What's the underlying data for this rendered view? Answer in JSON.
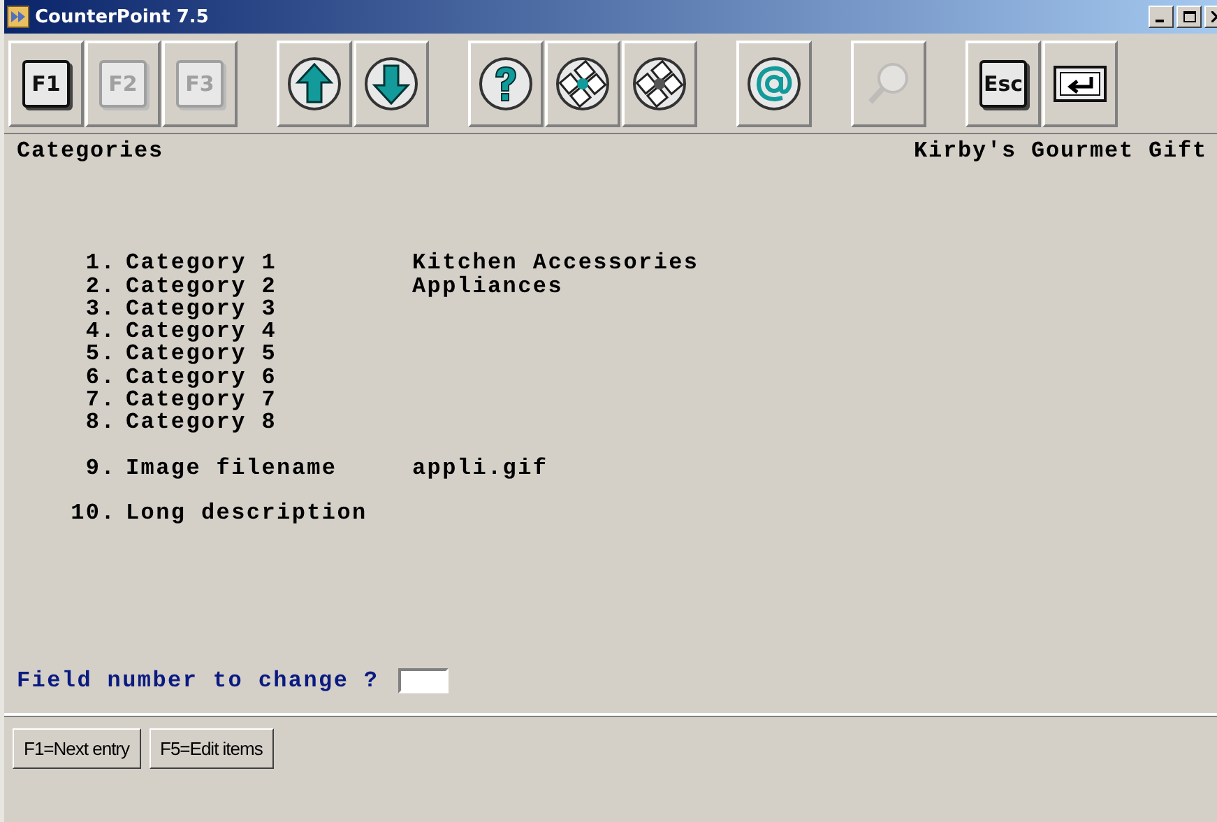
{
  "window": {
    "title": "CounterPoint 7.5"
  },
  "toolbar_groups": [
    [
      {
        "kind": "key",
        "label": "F1",
        "disabled": false
      },
      {
        "kind": "key",
        "label": "F2",
        "disabled": true
      },
      {
        "kind": "key",
        "label": "F3",
        "disabled": true
      }
    ],
    [
      {
        "kind": "up",
        "disabled": false
      },
      {
        "kind": "down",
        "disabled": false
      }
    ],
    [
      {
        "kind": "help",
        "disabled": false
      },
      {
        "kind": "keypad-a",
        "disabled": false
      },
      {
        "kind": "keypad-b",
        "disabled": false
      }
    ],
    [
      {
        "kind": "at",
        "disabled": false
      }
    ],
    [
      {
        "kind": "magnifier",
        "disabled": true
      }
    ],
    [
      {
        "kind": "key",
        "label": "Esc",
        "disabled": false
      },
      {
        "kind": "enter",
        "disabled": false
      }
    ]
  ],
  "header": {
    "screen": "Categories",
    "company": "Kirby's Gourmet Gift"
  },
  "field_groups": [
    [
      {
        "number": "1.",
        "label": "Category 1",
        "value": "Kitchen Accessories"
      },
      {
        "number": "2.",
        "label": "Category 2",
        "value": "Appliances"
      },
      {
        "number": "3.",
        "label": "Category 3"
      },
      {
        "number": "4.",
        "label": "Category 4"
      },
      {
        "number": "5.",
        "label": "Category 5"
      },
      {
        "number": "6.",
        "label": "Category 6"
      },
      {
        "number": "7.",
        "label": "Category 7"
      },
      {
        "number": "8.",
        "label": "Category 8"
      }
    ],
    [
      {
        "number": "9.",
        "label": "Image filename",
        "value": "appli.gif"
      }
    ],
    [
      {
        "number": "10.",
        "label": "Long description"
      }
    ]
  ],
  "prompt": {
    "label": "Field number to change ?"
  },
  "function_keys": [
    "F1=Next entry",
    "F5=Edit items"
  ]
}
